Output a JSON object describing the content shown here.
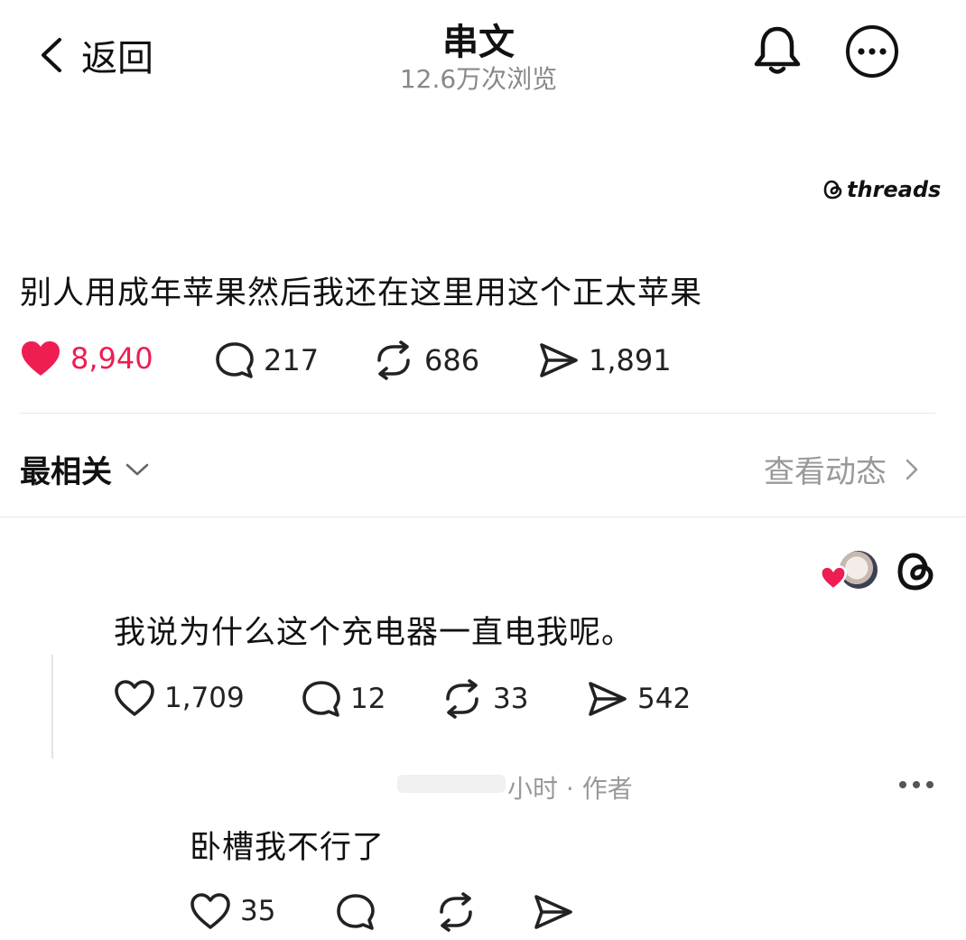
{
  "header": {
    "back_label": "返回",
    "title": "串文",
    "views": "12.6万次浏览"
  },
  "watermark": "threads",
  "post": {
    "text": "别人用成年苹果然后我还在这里用这个正太苹果",
    "likes": "8,940",
    "comments": "217",
    "reposts": "686",
    "shares": "1,891",
    "like_color": "#ee1d52"
  },
  "filter": {
    "sort_label": "最相关",
    "activity_label": "查看动态"
  },
  "reply1": {
    "text": "我说为什么这个充电器一直电我呢。",
    "likes": "1,709",
    "comments": "12",
    "reposts": "33",
    "shares": "542"
  },
  "reply2": {
    "meta": "小时 · 作者",
    "text": "卧槽我不行了",
    "likes": "35"
  }
}
